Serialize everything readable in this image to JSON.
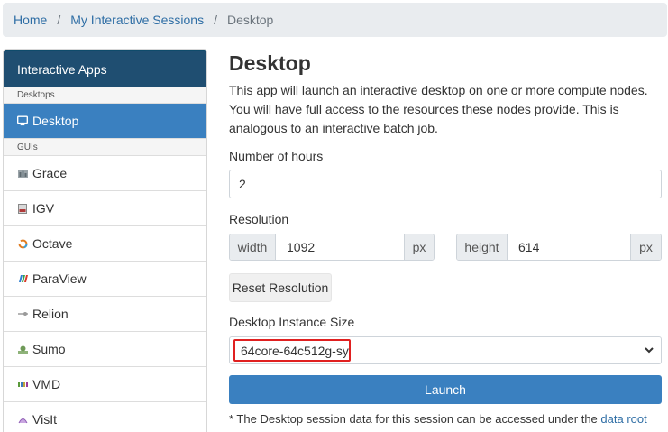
{
  "breadcrumb": {
    "home": "Home",
    "sessions": "My Interactive Sessions",
    "current": "Desktop",
    "separator": "/"
  },
  "sidebar": {
    "title": "Interactive Apps",
    "groups": [
      {
        "label": "Desktops",
        "items": [
          {
            "label": "Desktop",
            "icon": "monitor-icon",
            "active": true
          }
        ]
      },
      {
        "label": "GUIs",
        "items": [
          {
            "label": "Grace",
            "icon": "grace-icon"
          },
          {
            "label": "IGV",
            "icon": "igv-icon"
          },
          {
            "label": "Octave",
            "icon": "octave-icon"
          },
          {
            "label": "ParaView",
            "icon": "paraview-icon"
          },
          {
            "label": "Relion",
            "icon": "relion-icon"
          },
          {
            "label": "Sumo",
            "icon": "sumo-icon"
          },
          {
            "label": "VMD",
            "icon": "vmd-icon"
          },
          {
            "label": "VisIt",
            "icon": "visit-icon"
          }
        ]
      }
    ]
  },
  "main": {
    "title": "Desktop",
    "description": "This app will launch an interactive desktop on one or more compute nodes. You will have full access to the resources these nodes provide. This is analogous to an interactive batch job.",
    "hours_label": "Number of hours",
    "hours_value": "2",
    "resolution_label": "Resolution",
    "width_label": "width",
    "width_value": "1092",
    "width_unit": "px",
    "height_label": "height",
    "height_value": "614",
    "height_unit": "px",
    "reset_label": "Reset Resolution",
    "instance_label": "Desktop Instance Size",
    "instance_value": "64core-64c512g-sy",
    "launch_label": "Launch",
    "note_text": "* The Desktop session data for this session can be accessed under the",
    "note_link": "data root"
  },
  "colors": {
    "sidebar_header": "#1f4e71",
    "active_item": "#3a80c0",
    "launch_button": "#3a80c0",
    "link": "#2f6ea5",
    "highlight_box": "#e02020"
  }
}
